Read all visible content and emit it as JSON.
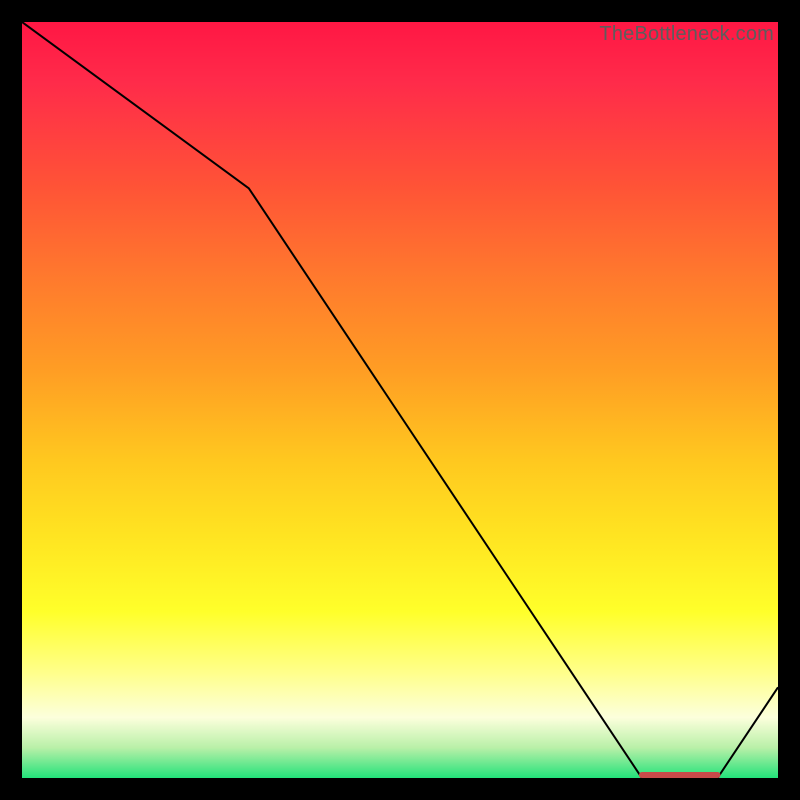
{
  "watermark": "TheBottleneck.com",
  "highlight_color": "#c74a4a",
  "chart_data": {
    "type": "line",
    "title": "",
    "xlabel": "",
    "ylabel": "",
    "xlim": [
      0,
      100
    ],
    "ylim": [
      0,
      100
    ],
    "x": [
      0,
      30,
      82,
      92,
      100
    ],
    "values": [
      100,
      78,
      0,
      0,
      12
    ],
    "highlight_segment": {
      "x_start": 82,
      "x_end": 92,
      "y": 0
    },
    "notes": "Black line descends from top-left, slope steepens after x≈30, reaches 0 around x≈82, stays at 0 until x≈92 (highlighted segment), then rises to ~12 at right edge. Background is a vertical red→green gradient. No axis ticks or labels visible. Watermark text in top-right."
  }
}
